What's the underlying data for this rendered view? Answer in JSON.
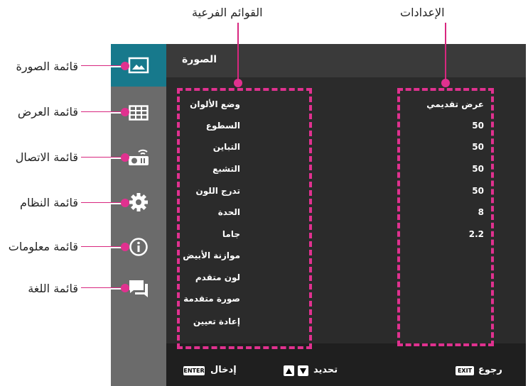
{
  "annotations": {
    "submenus_label": "القوائم الفرعية",
    "settings_label": "الإعدادات",
    "callouts": [
      {
        "label": "قائمة الصورة",
        "icon": "image-icon"
      },
      {
        "label": "قائمة العرض",
        "icon": "grid-icon"
      },
      {
        "label": "قائمة الاتصال",
        "icon": "projector-wifi-icon"
      },
      {
        "label": "قائمة النظام",
        "icon": "gear-icon"
      },
      {
        "label": "قائمة معلومات",
        "icon": "info-icon"
      },
      {
        "label": "قائمة اللغة",
        "icon": "language-chat-icon"
      }
    ]
  },
  "screen": {
    "title": "الصورة",
    "menu_items": [
      {
        "label": "وضع الألوان",
        "value": "عرض تقديمي"
      },
      {
        "label": "السطوع",
        "value": "50"
      },
      {
        "label": "التباين",
        "value": "50"
      },
      {
        "label": "التشبع",
        "value": "50"
      },
      {
        "label": "تدرج اللون",
        "value": "50"
      },
      {
        "label": "الحدة",
        "value": "8"
      },
      {
        "label": "جاما",
        "value": "2.2"
      },
      {
        "label": "موازنة الأبيض",
        "value": ""
      },
      {
        "label": "لون متقدم",
        "value": ""
      },
      {
        "label": "صورة متقدمة",
        "value": ""
      },
      {
        "label": "إعادة تعيين",
        "value": ""
      }
    ],
    "footer": {
      "enter_label": "إدخال",
      "enter_key": "ENTER",
      "select_label": "تحديد",
      "back_label": "رجوع",
      "exit_key": "EXIT"
    }
  },
  "colors": {
    "accent": "#17798c",
    "highlight": "#e0318f"
  }
}
